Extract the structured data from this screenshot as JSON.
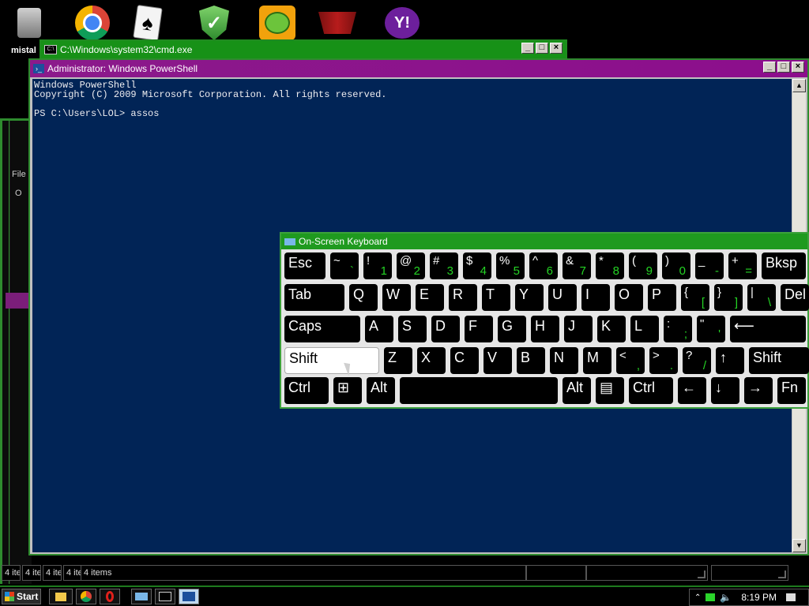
{
  "desktop": {
    "partial_label": "mistal",
    "bg_window_fragments": [
      "File",
      "O"
    ]
  },
  "cmd": {
    "title": "C:\\Windows\\system32\\cmd.exe",
    "icon": "C:\\"
  },
  "powershell": {
    "title": "Administrator: Windows PowerShell",
    "console": "Windows PowerShell\nCopyright (C) 2009 Microsoft Corporation. All rights reserved.\n\nPS C:\\Users\\LOL> assos"
  },
  "caption": {
    "minimize": "_",
    "maximize": "□",
    "close": "×"
  },
  "osk": {
    "title": "On-Screen Keyboard",
    "row1": [
      {
        "label": "Esc"
      },
      {
        "top": "~",
        "bot": "`"
      },
      {
        "top": "!",
        "bot": "1"
      },
      {
        "top": "@",
        "bot": "2"
      },
      {
        "top": "#",
        "bot": "3"
      },
      {
        "top": "$",
        "bot": "4"
      },
      {
        "top": "%",
        "bot": "5"
      },
      {
        "top": "^",
        "bot": "6"
      },
      {
        "top": "&",
        "bot": "7"
      },
      {
        "top": "*",
        "bot": "8"
      },
      {
        "top": "(",
        "bot": "9"
      },
      {
        "top": ")",
        "bot": "0"
      },
      {
        "top": "_",
        "bot": "-"
      },
      {
        "top": "+",
        "bot": "="
      },
      {
        "label": "Bksp"
      }
    ],
    "row2": [
      {
        "label": "Tab"
      },
      {
        "label": "Q"
      },
      {
        "label": "W"
      },
      {
        "label": "E"
      },
      {
        "label": "R"
      },
      {
        "label": "T"
      },
      {
        "label": "Y"
      },
      {
        "label": "U"
      },
      {
        "label": "I"
      },
      {
        "label": "O"
      },
      {
        "label": "P"
      },
      {
        "top": "{",
        "bot": "["
      },
      {
        "top": "}",
        "bot": "]"
      },
      {
        "top": "|",
        "bot": "\\"
      },
      {
        "label": "Del"
      }
    ],
    "row3": [
      {
        "label": "Caps"
      },
      {
        "label": "A"
      },
      {
        "label": "S"
      },
      {
        "label": "D"
      },
      {
        "label": "F"
      },
      {
        "label": "G"
      },
      {
        "label": "H"
      },
      {
        "label": "J"
      },
      {
        "label": "K"
      },
      {
        "label": "L"
      },
      {
        "top": ":",
        "bot": ";"
      },
      {
        "top": "\"",
        "bot": "'"
      },
      {
        "label": "⟵"
      }
    ],
    "row4": [
      {
        "label": "Shift"
      },
      {
        "label": "Z"
      },
      {
        "label": "X"
      },
      {
        "label": "C"
      },
      {
        "label": "V"
      },
      {
        "label": "B"
      },
      {
        "label": "N"
      },
      {
        "label": "M"
      },
      {
        "top": "<",
        "bot": ","
      },
      {
        "top": ">",
        "bot": "."
      },
      {
        "top": "?",
        "bot": "/"
      },
      {
        "label": "↑"
      },
      {
        "label": "Shift"
      }
    ],
    "row5": [
      {
        "label": "Ctrl"
      },
      {
        "label": "⊞"
      },
      {
        "label": "Alt"
      },
      {
        "label": ""
      },
      {
        "label": "Alt"
      },
      {
        "label": "▤"
      },
      {
        "label": "Ctrl"
      },
      {
        "label": "←"
      },
      {
        "label": "↓"
      },
      {
        "label": "→"
      },
      {
        "label": "Fn"
      }
    ]
  },
  "statusbar": {
    "small": [
      "4 ite",
      "4 ite",
      "4 ite",
      "4 ite"
    ],
    "main": "4 items"
  },
  "taskbar": {
    "start": "Start",
    "clock": "8:19 PM"
  }
}
